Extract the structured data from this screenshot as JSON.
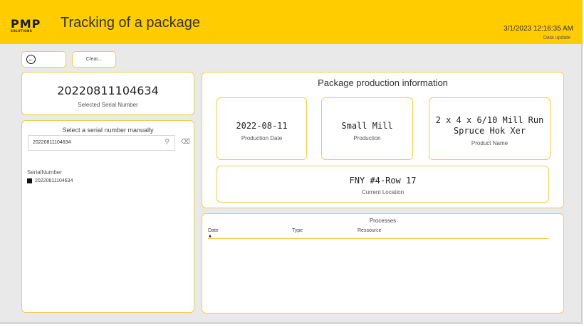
{
  "header": {
    "logo_main": "PMP",
    "logo_sub": "SOLUTIONS",
    "title": "Tracking of a package",
    "datetime": "3/1/2023 12:16:35 AM",
    "data_update": "Data update"
  },
  "toolbar": {
    "back_icon": "back-arrow-circle-icon",
    "clear_label": "Clear..."
  },
  "selected": {
    "serial_number": "20220811104634",
    "caption": "Selected Serial Number"
  },
  "select_panel": {
    "title": "Select a serial number manually",
    "search_value": "20220811104634",
    "list_header": "SerialNumber",
    "items": [
      {
        "label": "20220811104634",
        "checked": true
      }
    ]
  },
  "production": {
    "title": "Package production information",
    "date_value": "2022-08-11",
    "date_caption": "Production Date",
    "prod_value": "Small Mill",
    "prod_caption": "Production",
    "name_line1": "2 x 4 x 6/10 Mill Run",
    "name_line2": "Spruce Hok Xer",
    "name_caption": "Product Name",
    "location_value": "FNY #4-Row 17",
    "location_caption": "Current Location"
  },
  "processes": {
    "title": "Processes",
    "columns": [
      "Date",
      "Type",
      "Ressource"
    ]
  }
}
